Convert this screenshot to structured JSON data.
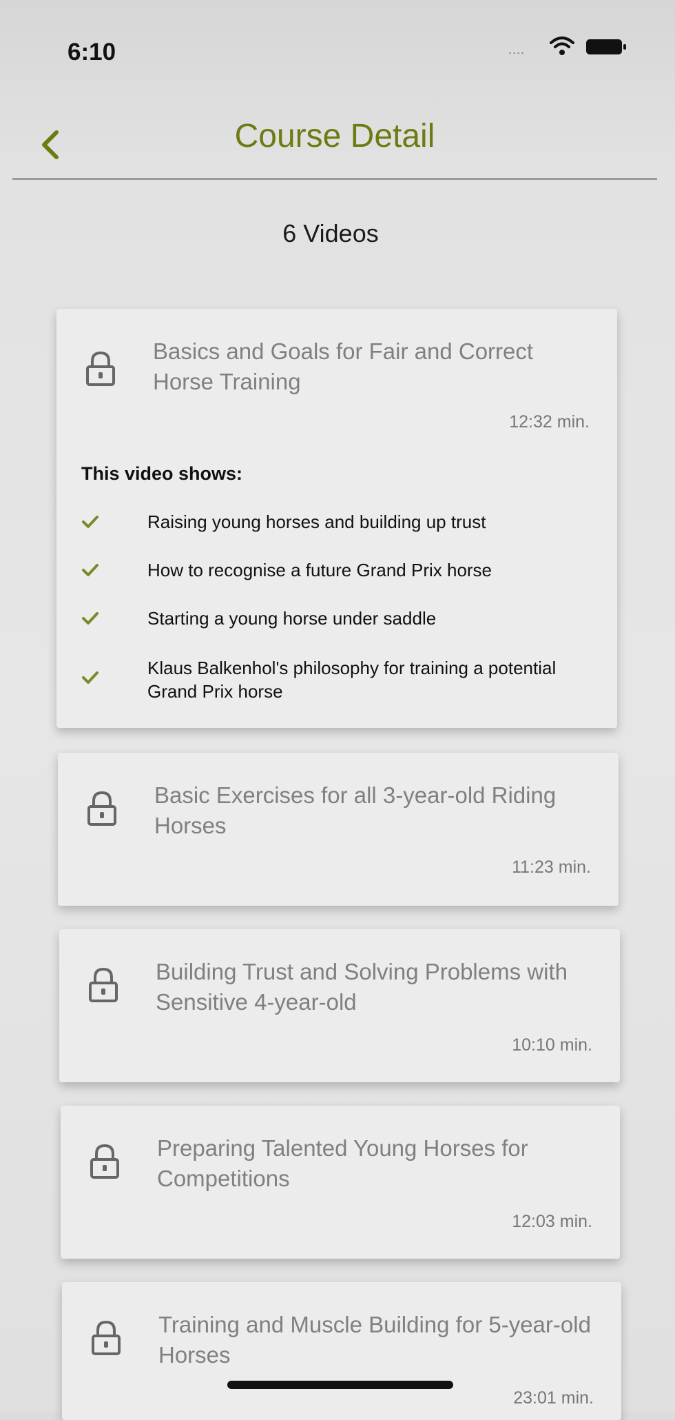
{
  "status_bar": {
    "time": "6:10",
    "signal": "...."
  },
  "nav": {
    "title": "Course Detail"
  },
  "video_count": "6 Videos",
  "colors": {
    "accent": "#6f7a12",
    "check": "#7a8a2a",
    "muted_text": "#808080"
  },
  "icons": {
    "back": "chevron-left-icon",
    "lock": "lock-icon",
    "check": "check-icon",
    "wifi": "wifi-icon",
    "battery": "battery-icon"
  },
  "videos": [
    {
      "title": "Basics and Goals for Fair and Correct Horse Training",
      "duration": "12:32 min.",
      "expanded": true,
      "locked": true,
      "details_heading": "This video shows:",
      "features": [
        "Raising young horses and building up trust",
        "How to recognise a future Grand Prix horse",
        "Starting a young horse under saddle",
        "Klaus Balkenhol's philosophy for training a potential Grand Prix horse"
      ]
    },
    {
      "title": "Basic Exercises for all 3-year-old Riding Horses",
      "duration": "11:23 min.",
      "locked": true
    },
    {
      "title": "Building Trust and Solving Problems with Sensitive 4-year-old",
      "duration": "10:10 min.",
      "locked": true
    },
    {
      "title": "Preparing Talented Young Horses for Competitions",
      "duration": "12:03 min.",
      "locked": true
    },
    {
      "title": "Training and Muscle Building for 5-year-old Horses",
      "duration": "23:01 min.",
      "locked": true
    }
  ]
}
